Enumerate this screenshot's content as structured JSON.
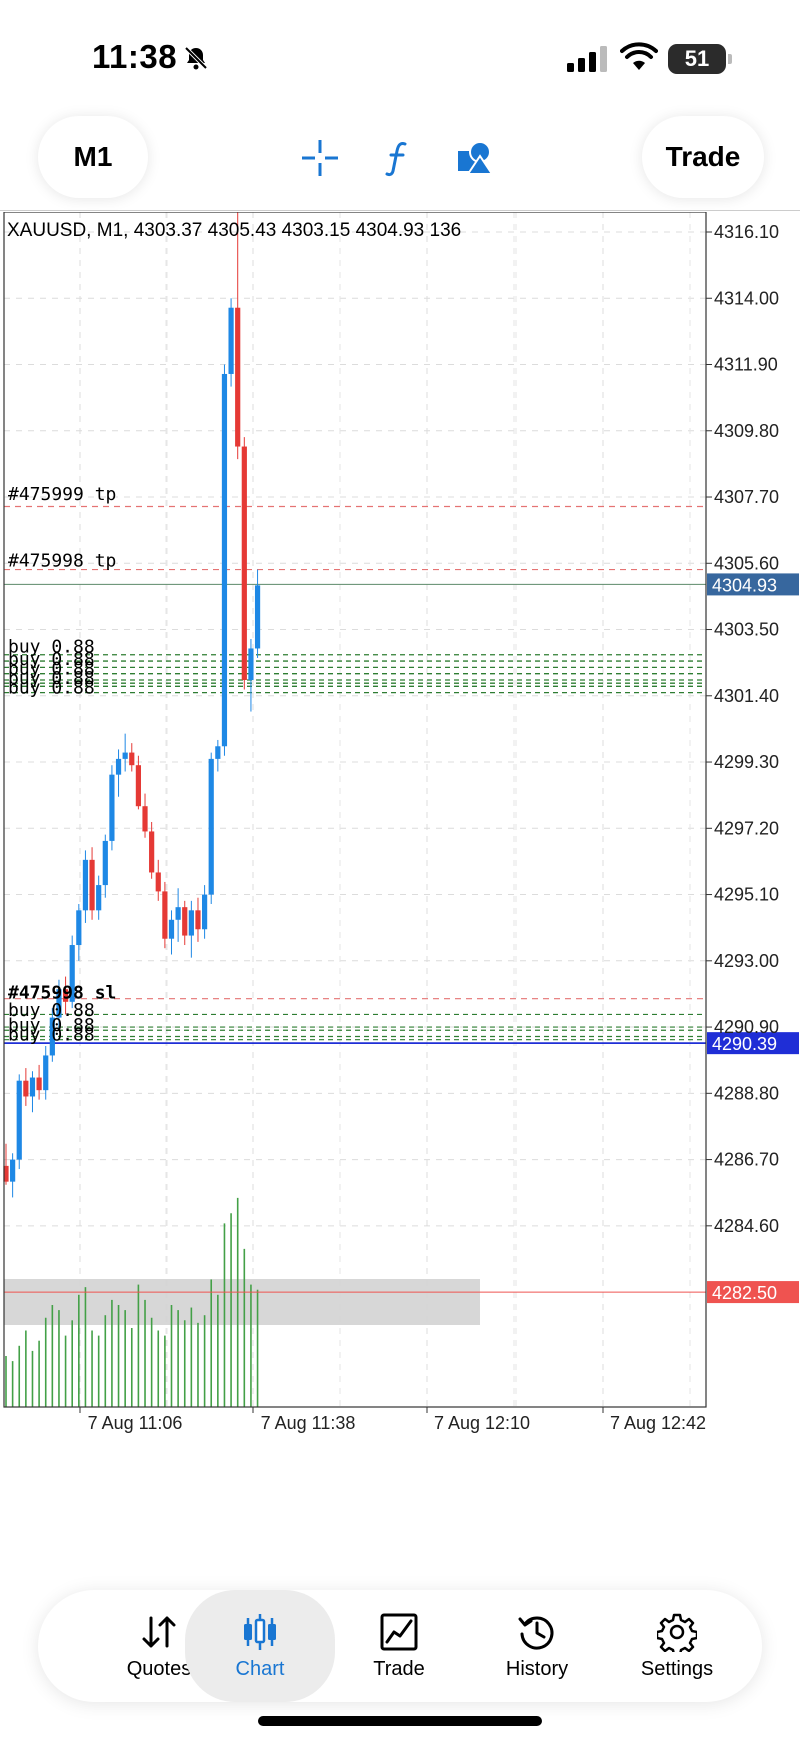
{
  "status_bar": {
    "time": "11:38",
    "battery": "51"
  },
  "toolbar": {
    "timeframe": "M1",
    "trade_label": "Trade"
  },
  "chart": {
    "header": "XAUUSD, M1, 4303.37 4305.43 4303.15 4304.93 136",
    "y_ticks": [
      "4316.10",
      "4314.00",
      "4311.90",
      "4309.80",
      "4307.70",
      "4305.60",
      "4303.50",
      "4301.40",
      "4299.30",
      "4297.20",
      "4295.10",
      "4293.00",
      "4290.90",
      "4288.80",
      "4286.70",
      "4284.60"
    ],
    "x_ticks": [
      "7 Aug 11:06",
      "7 Aug 11:38",
      "7 Aug 12:10",
      "7 Aug 12:42"
    ],
    "current_price": "4304.93",
    "blue_level": "4290.39",
    "red_level": "4282.50",
    "order_labels": [
      "#475999 tp",
      "#475998 tp",
      "buy 0.88",
      "#475998 sl"
    ],
    "colors": {
      "bull": "#1e88e5",
      "bear": "#e53935",
      "volume": "#43a047",
      "blue_level": "#1f2ed6",
      "red_level": "#ef5350",
      "current": "#37679e"
    }
  },
  "chart_data": {
    "type": "candlestick",
    "symbol": "XAUUSD",
    "timeframe": "M1",
    "ylim": [
      4282.5,
      4317.0
    ],
    "candles": [
      {
        "o": 4286.5,
        "h": 4287.2,
        "l": 4285.9,
        "c": 4286.0
      },
      {
        "o": 4286.0,
        "h": 4286.9,
        "l": 4285.5,
        "c": 4286.7
      },
      {
        "o": 4286.7,
        "h": 4289.4,
        "l": 4286.4,
        "c": 4289.2
      },
      {
        "o": 4289.2,
        "h": 4289.6,
        "l": 4288.4,
        "c": 4288.7
      },
      {
        "o": 4288.7,
        "h": 4289.5,
        "l": 4288.2,
        "c": 4289.3
      },
      {
        "o": 4289.3,
        "h": 4289.7,
        "l": 4288.6,
        "c": 4288.9
      },
      {
        "o": 4288.9,
        "h": 4290.3,
        "l": 4288.6,
        "c": 4290.0
      },
      {
        "o": 4290.0,
        "h": 4291.5,
        "l": 4289.8,
        "c": 4291.2
      },
      {
        "o": 4291.2,
        "h": 4292.4,
        "l": 4290.8,
        "c": 4292.1
      },
      {
        "o": 4292.1,
        "h": 4292.5,
        "l": 4291.3,
        "c": 4291.7
      },
      {
        "o": 4291.7,
        "h": 4293.8,
        "l": 4291.5,
        "c": 4293.5
      },
      {
        "o": 4293.5,
        "h": 4294.8,
        "l": 4293.0,
        "c": 4294.6
      },
      {
        "o": 4294.6,
        "h": 4296.5,
        "l": 4294.2,
        "c": 4296.2
      },
      {
        "o": 4296.2,
        "h": 4296.6,
        "l": 4294.3,
        "c": 4294.6
      },
      {
        "o": 4294.6,
        "h": 4295.7,
        "l": 4294.3,
        "c": 4295.4
      },
      {
        "o": 4295.4,
        "h": 4297.0,
        "l": 4295.0,
        "c": 4296.8
      },
      {
        "o": 4296.8,
        "h": 4299.2,
        "l": 4296.5,
        "c": 4298.9
      },
      {
        "o": 4298.9,
        "h": 4299.7,
        "l": 4298.2,
        "c": 4299.4
      },
      {
        "o": 4299.4,
        "h": 4300.2,
        "l": 4299.0,
        "c": 4299.6
      },
      {
        "o": 4299.6,
        "h": 4299.9,
        "l": 4299.0,
        "c": 4299.2
      },
      {
        "o": 4299.2,
        "h": 4299.5,
        "l": 4297.8,
        "c": 4297.9
      },
      {
        "o": 4297.9,
        "h": 4298.3,
        "l": 4296.9,
        "c": 4297.1
      },
      {
        "o": 4297.1,
        "h": 4297.4,
        "l": 4295.6,
        "c": 4295.8
      },
      {
        "o": 4295.8,
        "h": 4296.2,
        "l": 4294.9,
        "c": 4295.2
      },
      {
        "o": 4295.2,
        "h": 4295.5,
        "l": 4293.4,
        "c": 4293.7
      },
      {
        "o": 4293.7,
        "h": 4294.6,
        "l": 4293.2,
        "c": 4294.3
      },
      {
        "o": 4294.3,
        "h": 4295.3,
        "l": 4293.6,
        "c": 4294.7
      },
      {
        "o": 4294.7,
        "h": 4294.9,
        "l": 4293.5,
        "c": 4293.8
      },
      {
        "o": 4293.8,
        "h": 4294.9,
        "l": 4293.1,
        "c": 4294.6
      },
      {
        "o": 4294.6,
        "h": 4295.0,
        "l": 4293.6,
        "c": 4294.0
      },
      {
        "o": 4294.0,
        "h": 4295.4,
        "l": 4293.7,
        "c": 4295.1
      },
      {
        "o": 4295.1,
        "h": 4299.6,
        "l": 4294.8,
        "c": 4299.4
      },
      {
        "o": 4299.4,
        "h": 4300.0,
        "l": 4299.0,
        "c": 4299.8
      },
      {
        "o": 4299.8,
        "h": 4311.9,
        "l": 4299.5,
        "c": 4311.6
      },
      {
        "o": 4311.6,
        "h": 4314.0,
        "l": 4311.2,
        "c": 4313.7
      },
      {
        "o": 4313.7,
        "h": 4317.0,
        "l": 4308.9,
        "c": 4309.3
      },
      {
        "o": 4309.3,
        "h": 4309.6,
        "l": 4301.6,
        "c": 4301.9
      },
      {
        "o": 4301.9,
        "h": 4303.2,
        "l": 4300.9,
        "c": 4302.9
      },
      {
        "o": 4302.9,
        "h": 4305.4,
        "l": 4302.6,
        "c": 4304.9
      }
    ],
    "volumes": [
      20,
      18,
      24,
      30,
      22,
      26,
      35,
      40,
      38,
      28,
      34,
      44,
      47,
      30,
      28,
      36,
      42,
      40,
      38,
      31,
      48,
      42,
      35,
      30,
      28,
      40,
      38,
      34,
      39,
      33,
      36,
      50,
      44,
      72,
      76,
      82,
      62,
      48,
      46
    ],
    "order_levels": {
      "tp": [
        4307.4,
        4305.4
      ],
      "buy": [
        4302.7,
        4302.5,
        4302.3,
        4302.1,
        4301.9,
        4301.8,
        4301.7,
        4301.5
      ],
      "sl_buy_lower": [
        4290.9,
        4290.8,
        4290.6,
        4290.5
      ],
      "sl": [
        4291.8
      ],
      "buy_lower": [
        4291.3
      ]
    },
    "current_price": 4304.93,
    "blue_level": 4290.39,
    "red_level": 4282.5
  },
  "nav": {
    "items": [
      {
        "label": "Quotes"
      },
      {
        "label": "Chart"
      },
      {
        "label": "Trade"
      },
      {
        "label": "History"
      },
      {
        "label": "Settings"
      }
    ]
  }
}
